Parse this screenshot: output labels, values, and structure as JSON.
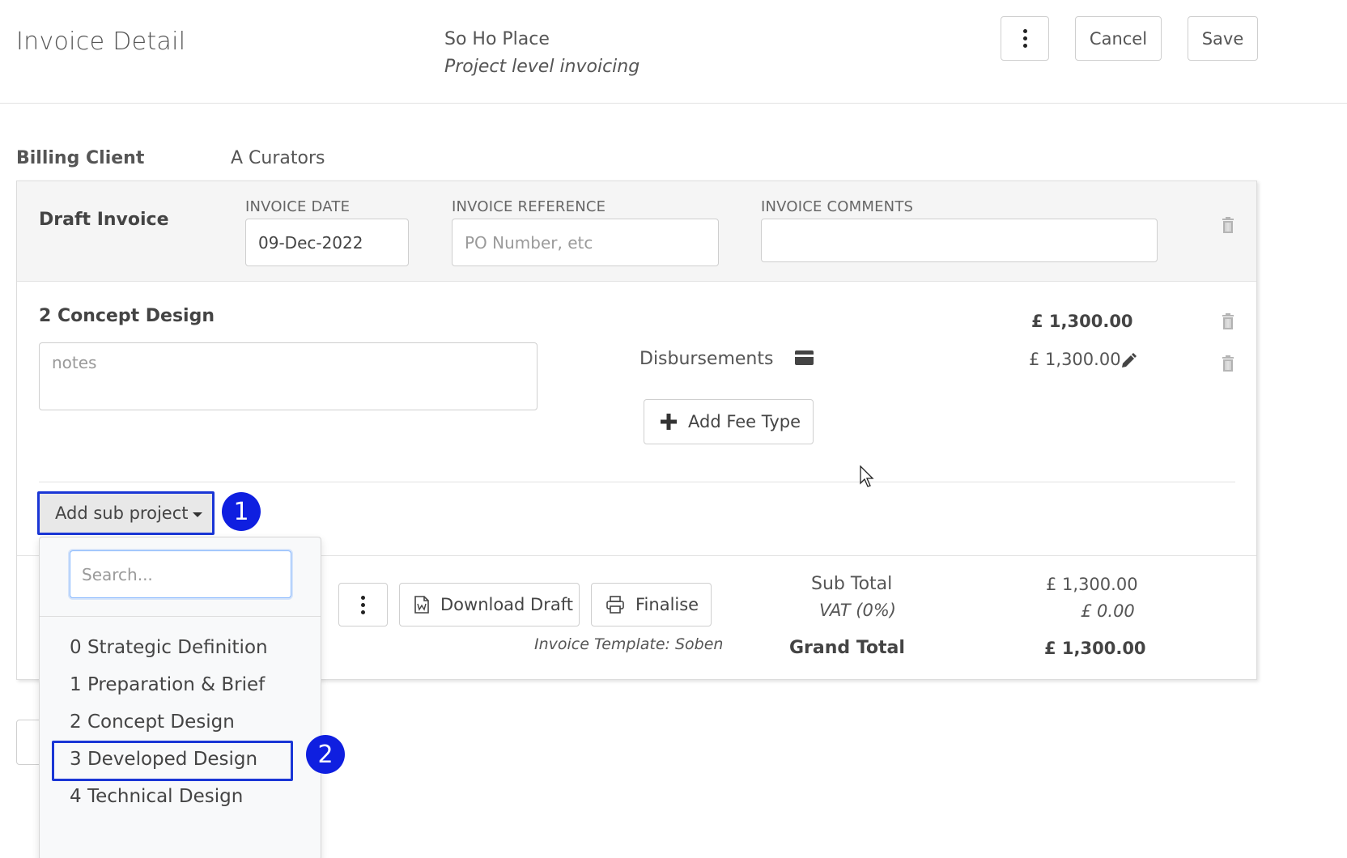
{
  "header": {
    "title": "Invoice Detail",
    "project_name": "So Ho Place",
    "project_subtitle": "Project level invoicing",
    "cancel_label": "Cancel",
    "save_label": "Save"
  },
  "billing": {
    "label": "Billing Client",
    "value": "A Curators"
  },
  "invoice": {
    "title": "Draft Invoice",
    "date_label": "INVOICE DATE",
    "date_value": "09-Dec-2022",
    "reference_label": "INVOICE REFERENCE",
    "reference_placeholder": "PO Number, etc",
    "comments_label": "INVOICE COMMENTS",
    "comments_value": ""
  },
  "section": {
    "title": "2 Concept Design",
    "notes_placeholder": "notes",
    "amount": "£ 1,300.00",
    "disbursements_label": "Disbursements",
    "disbursements_amount": "£ 1,300.00",
    "add_fee_label": "Add Fee Type"
  },
  "add_sub_project": {
    "label": "Add sub project",
    "step_badge": "1"
  },
  "dropdown": {
    "search_placeholder": "Search...",
    "items": [
      "0 Strategic Definition",
      "1 Preparation & Brief",
      "2 Concept Design",
      "3 Developed Design",
      "4 Technical Design"
    ],
    "highlighted_item": "3 Developed Design",
    "step_badge": "2"
  },
  "footer": {
    "download_label": "Download Draft",
    "finalise_label": "Finalise",
    "template_note": "Invoice Template: Soben",
    "subtotal_label": "Sub Total",
    "subtotal_value": "£ 1,300.00",
    "vat_label": "VAT (0%)",
    "vat_value": "£ 0.00",
    "grand_total_label": "Grand Total",
    "grand_total_value": "£ 1,300.00"
  },
  "colors": {
    "highlight": "#1a36d6",
    "badge": "#0f1fe0",
    "card_header_bg": "#f5f5f5"
  }
}
